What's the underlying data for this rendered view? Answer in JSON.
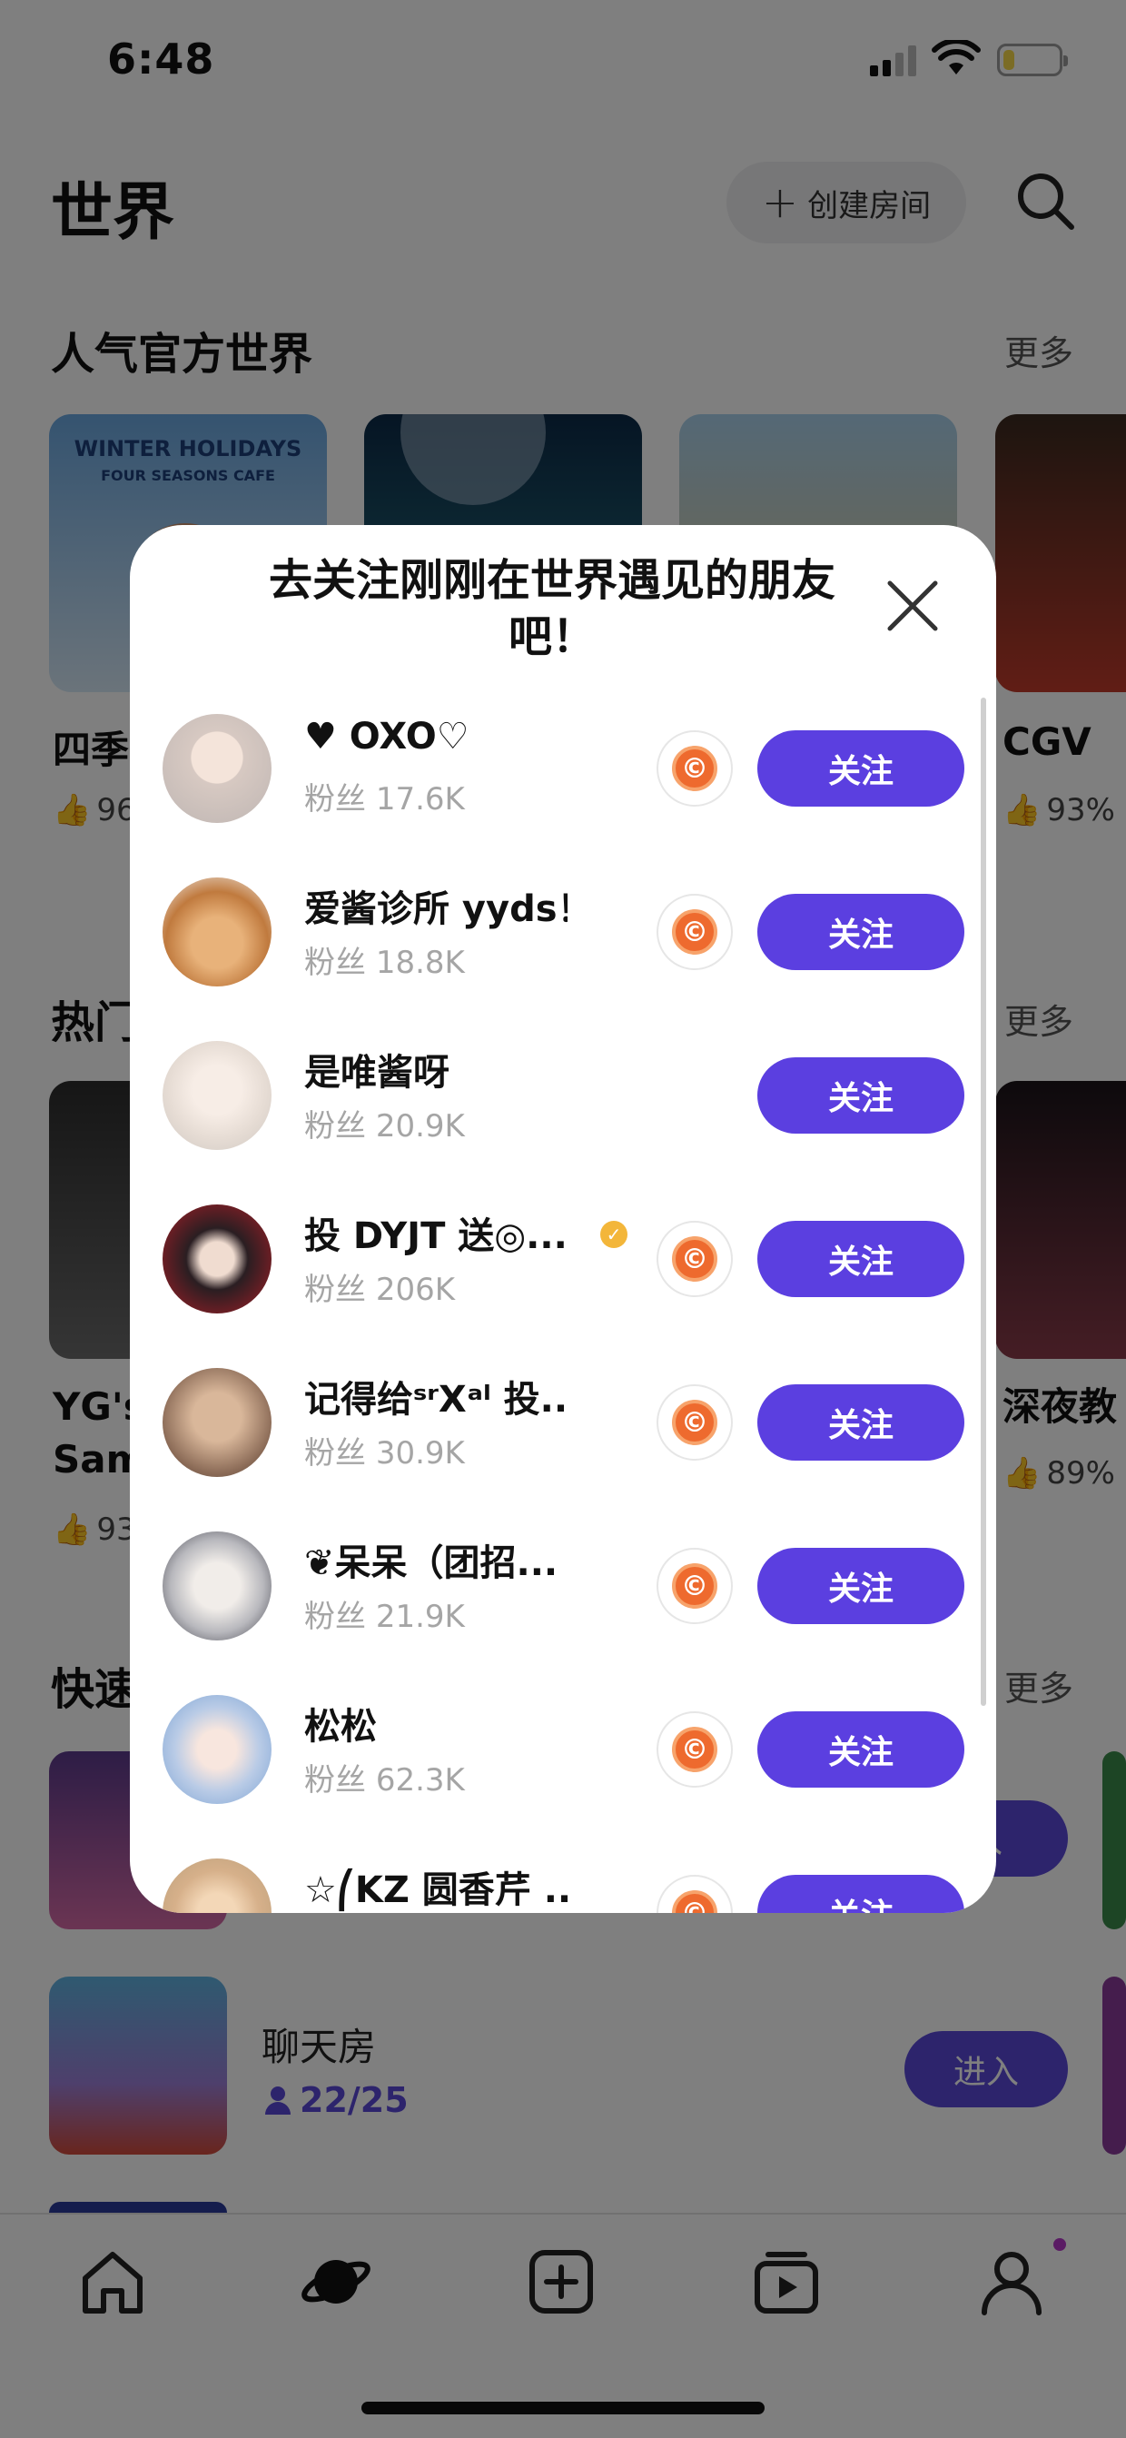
{
  "status_bar": {
    "time": "6:48",
    "battery_level": 0.18
  },
  "header": {
    "title": "世界",
    "create_room_label": "创建房间"
  },
  "official_worlds": {
    "title": "人气官方世界",
    "more": "更多",
    "items": [
      {
        "name": "四季",
        "like": "96",
        "cover_text": "WINTER HOLIDAYS",
        "cover_sub": "FOUR SEASONS CAFE"
      },
      {
        "name": "",
        "like": ""
      },
      {
        "name": "",
        "like": ""
      },
      {
        "name": "CGV",
        "like": "93%"
      }
    ]
  },
  "hot_worlds": {
    "title": "热门",
    "more": "更多",
    "items": [
      {
        "name_line1": "YG's",
        "name_line2": "Sam",
        "like": "93"
      },
      {
        "name_line1": "深夜教",
        "name_line2": "",
        "like": "89%"
      }
    ]
  },
  "quick_rooms": {
    "title": "快速",
    "more": "更多",
    "items": [
      {
        "name": "",
        "count": "",
        "enter": "入"
      },
      {
        "name": "聊天房",
        "count": "22/25",
        "enter": "进入"
      }
    ]
  },
  "bottom_nav": {
    "tabs": [
      {
        "icon": "home-icon"
      },
      {
        "icon": "planet-icon",
        "active": true
      },
      {
        "icon": "add-icon"
      },
      {
        "icon": "play-icon"
      },
      {
        "icon": "profile-icon"
      }
    ]
  },
  "modal": {
    "title": "去关注刚刚在世界遇见的朋友吧！",
    "fans_prefix": "粉丝",
    "follow_label": "关注",
    "users": [
      {
        "name": "♥ OXO♡",
        "fans": "17.6K",
        "has_coin": true,
        "verified": false
      },
      {
        "name": "爱酱诊所 yyds！",
        "fans": "18.8K",
        "has_coin": true,
        "verified": false
      },
      {
        "name": "是唯酱呀",
        "fans": "20.9K",
        "has_coin": false,
        "verified": false
      },
      {
        "name": "投 DYJT 送◎...",
        "fans": "206K",
        "has_coin": true,
        "verified": true
      },
      {
        "name": "记得给ˢʳXᵃˡ 投...",
        "fans": "30.9K",
        "has_coin": true,
        "verified": false
      },
      {
        "name": "❦呆呆（团招...",
        "fans": "21.9K",
        "has_coin": true,
        "verified": false
      },
      {
        "name": "松松",
        "fans": "62.3K",
        "has_coin": true,
        "verified": false
      },
      {
        "name": "☆⎛KZ 圆香芹 ...",
        "fans": "",
        "has_coin": true,
        "verified": false
      }
    ]
  }
}
